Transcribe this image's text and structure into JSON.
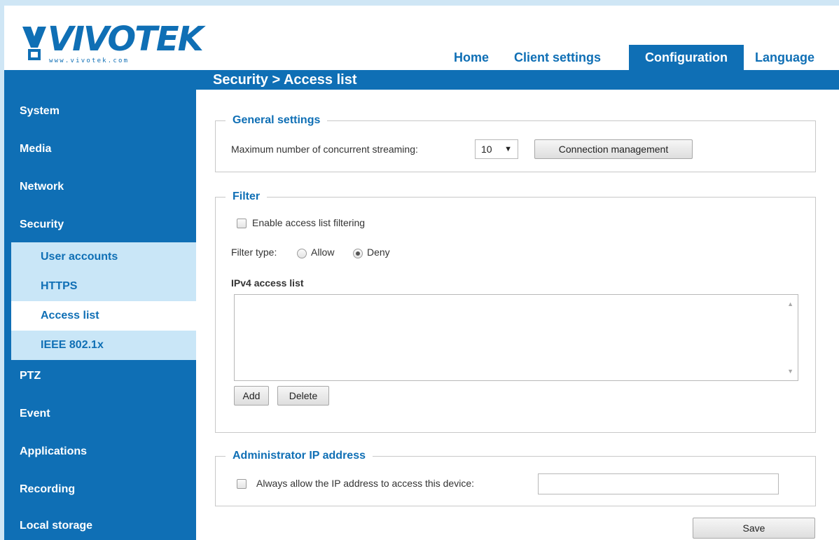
{
  "brand": {
    "name": "VIVOTEK",
    "url_text": "www.vivotek.com"
  },
  "nav": [
    {
      "label": "Home"
    },
    {
      "label": "Client settings"
    },
    {
      "label": "Configuration"
    },
    {
      "label": "Language"
    }
  ],
  "breadcrumb": "Security  > Access list",
  "sidebar": {
    "items": [
      {
        "label": "System"
      },
      {
        "label": "Media"
      },
      {
        "label": "Network"
      },
      {
        "label": "Security"
      },
      {
        "label": "PTZ"
      },
      {
        "label": "Event"
      },
      {
        "label": "Applications"
      },
      {
        "label": "Recording"
      },
      {
        "label": "Local storage"
      }
    ],
    "sub_items": [
      {
        "label": "User accounts"
      },
      {
        "label": "HTTPS"
      },
      {
        "label": "Access list"
      },
      {
        "label": "IEEE 802.1x"
      }
    ]
  },
  "general": {
    "legend": "General settings",
    "max_streaming_label": "Maximum number of concurrent streaming:",
    "max_streaming_value": "10",
    "connection_button": "Connection management"
  },
  "filter": {
    "legend": "Filter",
    "enable_label": "Enable access list filtering",
    "filter_type_label": "Filter type:",
    "allow_label": "Allow",
    "deny_label": "Deny",
    "ipv4_label": "IPv4 access list",
    "add_button": "Add",
    "delete_button": "Delete"
  },
  "admin": {
    "legend": "Administrator IP address",
    "always_allow_label": "Always allow the IP address to access this device:",
    "ip_value": ""
  },
  "save_button": "Save",
  "colors": {
    "brand_blue": "#0f6fb5",
    "submenu_bg": "#c9e6f7"
  }
}
